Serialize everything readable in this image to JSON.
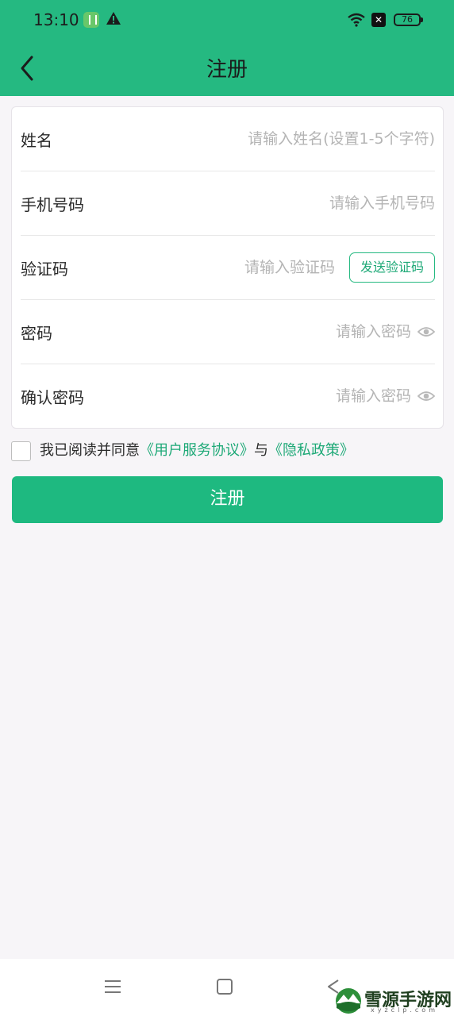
{
  "status_bar": {
    "time": "13:10",
    "battery": "76"
  },
  "header": {
    "title": "注册"
  },
  "form": {
    "name": {
      "label": "姓名",
      "placeholder": "请输入姓名(设置1-5个字符)"
    },
    "phone": {
      "label": "手机号码",
      "placeholder": "请输入手机号码"
    },
    "code": {
      "label": "验证码",
      "placeholder": "请输入验证码",
      "send_label": "发送验证码"
    },
    "password": {
      "label": "密码",
      "placeholder": "请输入密码"
    },
    "confirm": {
      "label": "确认密码",
      "placeholder": "请输入密码"
    }
  },
  "agreement": {
    "prefix": "我已阅读并同意",
    "terms_link": "《用户服务协议》",
    "joiner": "与",
    "privacy_link": "《隐私政策》"
  },
  "submit_label": "注册",
  "watermark": {
    "text": "雪源手游网",
    "sub": "xyzclp.com"
  },
  "colors": {
    "brand_green": "#25b981",
    "link_green": "#1ea977"
  },
  "icons": [
    "back-arrow-icon",
    "eye-icon",
    "warning-icon",
    "wifi-icon",
    "menu-icon",
    "home-icon",
    "nav-back-icon"
  ]
}
